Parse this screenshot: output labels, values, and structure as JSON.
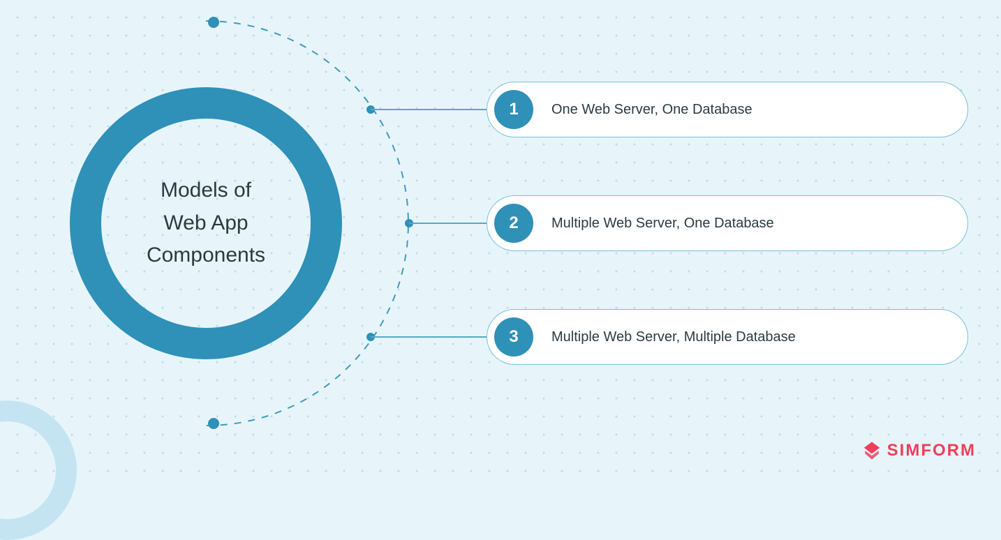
{
  "hub": {
    "line1": "Models of",
    "line2": "Web App",
    "line3": "Components"
  },
  "items": [
    {
      "number": "1",
      "label": "One Web Server, One Database"
    },
    {
      "number": "2",
      "label": "Multiple Web Server, One Database"
    },
    {
      "number": "3",
      "label": "Multiple Web Server, Multiple Database"
    }
  ],
  "brand": {
    "name": "SIMFORM"
  },
  "colors": {
    "background": "#e7f5fb",
    "accent": "#2f90b8",
    "pill_border": "#76c0d8",
    "brand": "#ef3f5b",
    "text": "#2b3a42"
  }
}
